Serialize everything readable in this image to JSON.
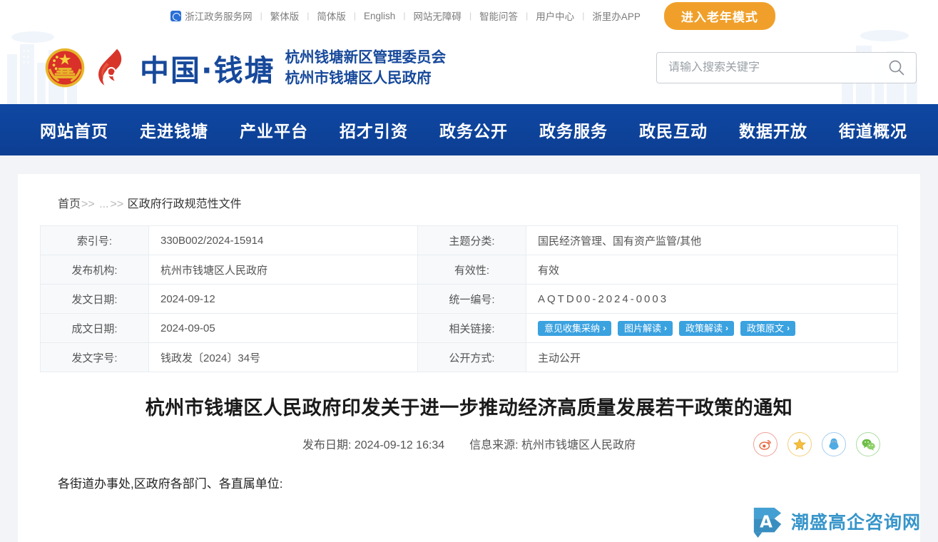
{
  "topbar": {
    "portal": "浙江政务服务网",
    "portal_icon": "zhejiang-portal-icon",
    "links": [
      "繁体版",
      "简体版",
      "English",
      "网站无障碍",
      "智能问答",
      "用户中心",
      "浙里办APP"
    ],
    "separator": "|",
    "elder_mode_button": "进入老年模式"
  },
  "header": {
    "emblem_icon": "national-emblem-icon",
    "flame_icon": "qiantang-flame-logo",
    "brand": "中国·钱塘",
    "sub_line1": "杭州钱塘新区管理委员会",
    "sub_line2": "杭州市钱塘区人民政府",
    "brand_color": "#17499b"
  },
  "search": {
    "placeholder": "请输入搜索关键字",
    "value": "",
    "icon": "search-icon"
  },
  "nav": {
    "items": [
      "网站首页",
      "走进钱塘",
      "产业平台",
      "招才引资",
      "政务公开",
      "政务服务",
      "政民互动",
      "数据开放",
      "街道概况"
    ],
    "bg_color": "#0d47a1"
  },
  "breadcrumb": {
    "home": "首页",
    "sep": ">>",
    "ellipsis": "...",
    "current": "区政府行政规范性文件"
  },
  "info_table": {
    "rows": [
      {
        "left_label": "索引号:",
        "left_value": "330B002/2024-15914",
        "right_label": "主题分类:",
        "right_value": "国民经济管理、国有资产监管/其他"
      },
      {
        "left_label": "发布机构:",
        "left_value": "杭州市钱塘区人民政府",
        "right_label": "有效性:",
        "right_value": "有效"
      },
      {
        "left_label": "发文日期:",
        "left_value": "2024-09-12",
        "right_label": "统一编号:",
        "right_value": "AQTD00-2024-0003"
      },
      {
        "left_label": "成文日期:",
        "left_value": "2024-09-05",
        "right_label": "相关链接:",
        "right_value": ""
      },
      {
        "left_label": "发文字号:",
        "left_value": "钱政发〔2024〕34号",
        "right_label": "公开方式:",
        "right_value": "主动公开"
      }
    ],
    "related_links": [
      {
        "label": "意见收集采纳",
        "chevron": "›"
      },
      {
        "label": "图片解读",
        "chevron": "›"
      },
      {
        "label": "政策解读",
        "chevron": "›"
      },
      {
        "label": "政策原文",
        "chevron": "›"
      }
    ],
    "badge_color": "#3ba2e0"
  },
  "article": {
    "title": "杭州市钱塘区人民政府印发关于进一步推动经济高质量发展若干政策的通知",
    "publish_label": "发布日期:",
    "publish_date": "2024-09-12 16:34",
    "source_label": "信息来源:",
    "source": "杭州市钱塘区人民政府",
    "body_first_line": "各街道办事处,区政府各部门、各直属单位:"
  },
  "share": {
    "items": [
      {
        "name": "weibo-icon",
        "title": "微博"
      },
      {
        "name": "favorite-star-icon",
        "title": "收藏"
      },
      {
        "name": "qq-icon",
        "title": "QQ"
      },
      {
        "name": "wechat-icon",
        "title": "微信"
      }
    ]
  },
  "watermark": {
    "logo_letter": "A",
    "text": "潮盛高企咨询网",
    "color": "#2d90c8"
  }
}
